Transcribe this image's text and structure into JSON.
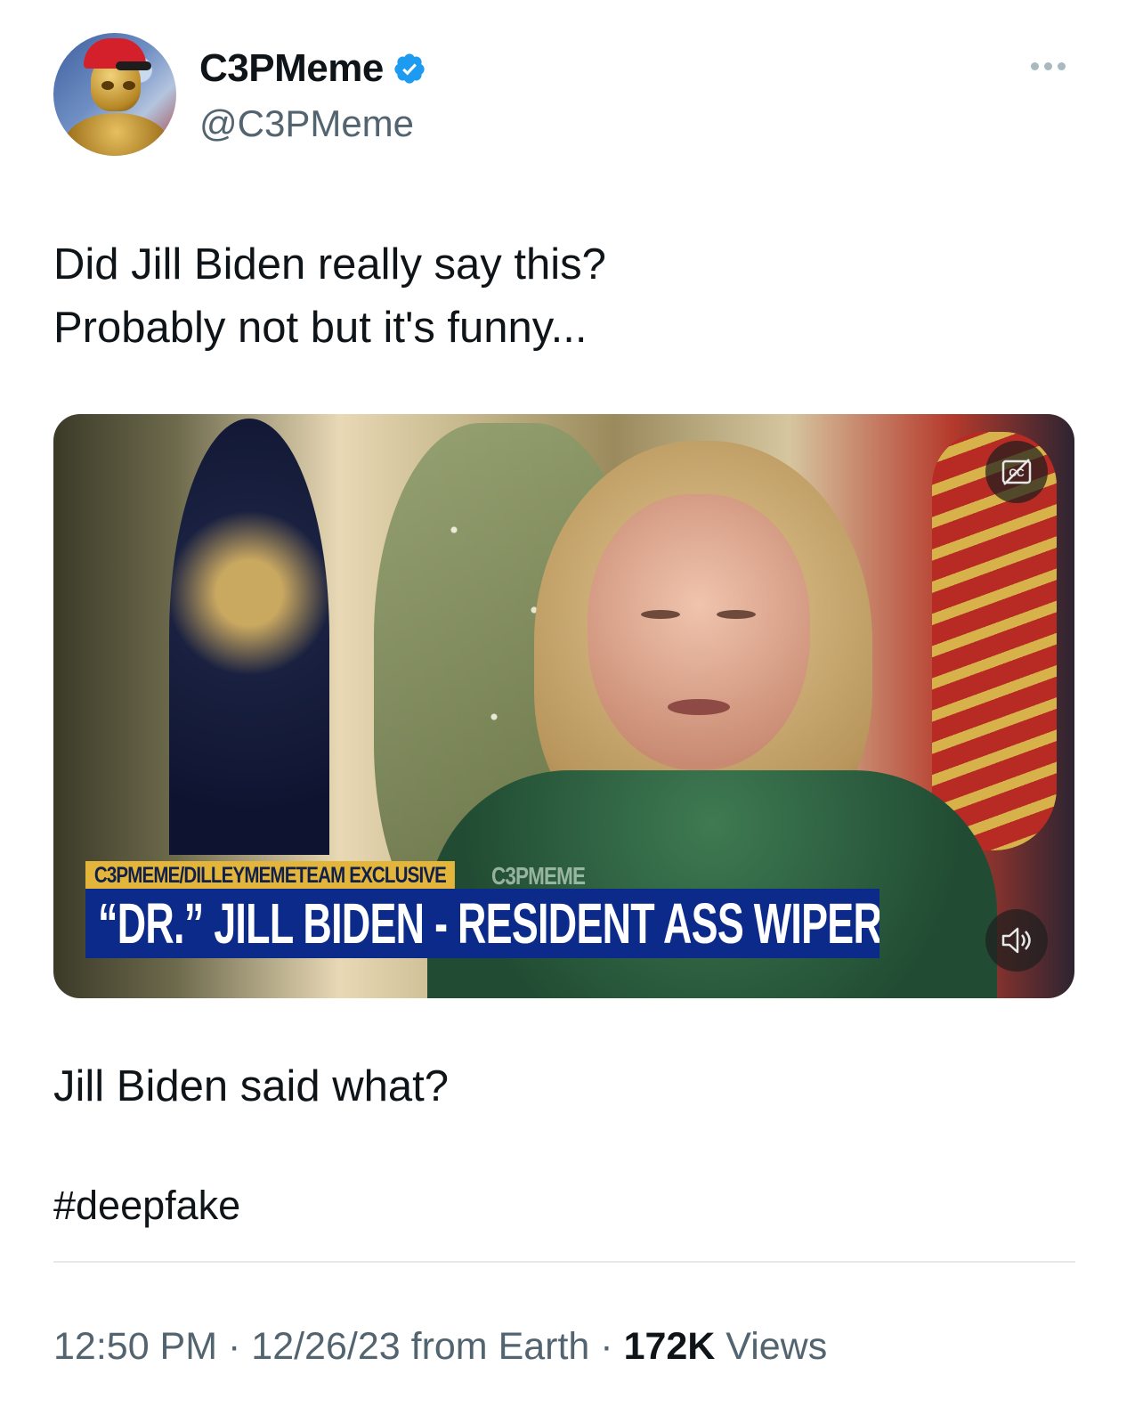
{
  "author": {
    "display_name": "C3PMeme",
    "handle": "@C3PMeme",
    "verified": true,
    "verified_icon": "verified-badge-icon",
    "verified_color": "#1d9bf0"
  },
  "tweet": {
    "text_line1": "Did Jill Biden really say this?",
    "text_line2": "Probably not but it's funny...",
    "reply_text": "Jill Biden said what?",
    "hashtag": "#deepfake"
  },
  "media": {
    "chyron_top": "C3PMEME/DILLEYMEMETEAM EXCLUSIVE",
    "watermark": "C3PMEME",
    "chyron_main": "“DR.” JILL BIDEN - RESIDENT ASS WIPER",
    "captions_icon": "closed-captions-icon",
    "volume_icon": "volume-muted-icon"
  },
  "footer": {
    "time": "12:50 PM",
    "sep1": " · ",
    "date": "12/26/23",
    "from": " from Earth",
    "sep2": " · ",
    "views_count": "172K",
    "views_label": " Views"
  }
}
